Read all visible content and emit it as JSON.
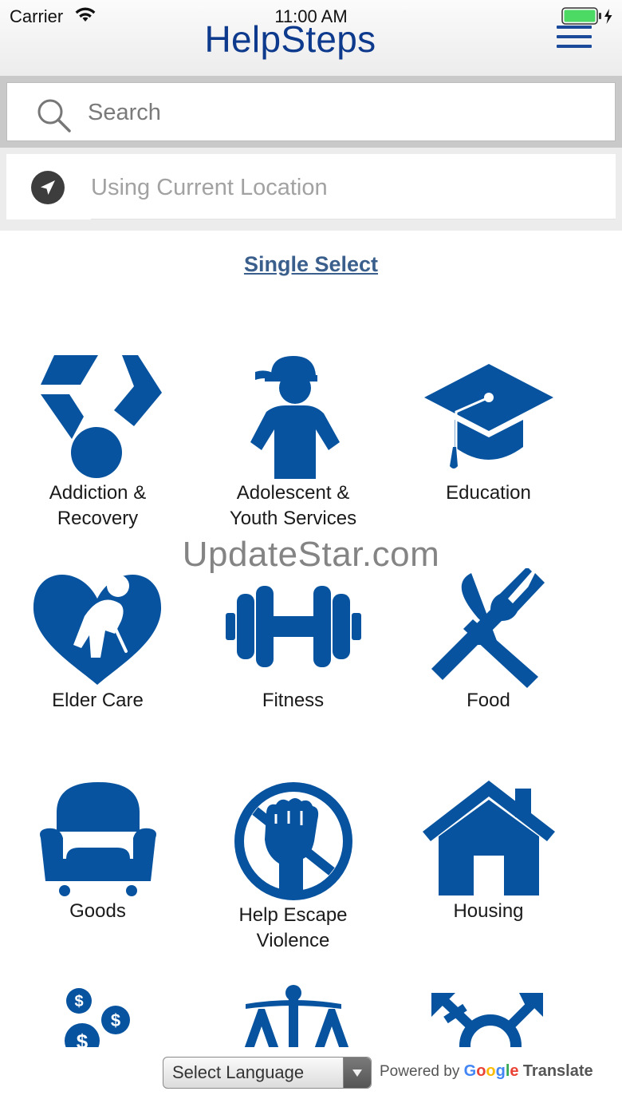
{
  "status_bar": {
    "carrier": "Carrier",
    "time": "11:00 AM"
  },
  "header": {
    "title": "HelpSteps"
  },
  "search": {
    "placeholder": "Search"
  },
  "location": {
    "placeholder": "Using Current Location"
  },
  "single_select": {
    "label": "Single Select"
  },
  "categories": [
    {
      "label": "Addiction &\nRecovery",
      "icon": "medal-icon"
    },
    {
      "label": "Adolescent &\nYouth Services",
      "icon": "youth-icon"
    },
    {
      "label": "Education",
      "icon": "graduation-cap-icon"
    },
    {
      "label": "Elder Care",
      "icon": "elder-heart-icon"
    },
    {
      "label": "Fitness",
      "icon": "dumbbell-icon"
    },
    {
      "label": "Food",
      "icon": "fork-knife-icon"
    },
    {
      "label": "Goods",
      "icon": "armchair-icon"
    },
    {
      "label": "Help Escape\nViolence",
      "icon": "no-violence-icon"
    },
    {
      "label": "Housing",
      "icon": "house-icon"
    },
    {
      "label": "",
      "icon": "money-icon"
    },
    {
      "label": "",
      "icon": "scales-icon"
    },
    {
      "label": "",
      "icon": "gender-icon"
    }
  ],
  "watermark": "UpdateStar.com",
  "translate": {
    "select_label": "Select Language",
    "powered_by": "Powered by",
    "google": "Google",
    "translate_word": "Translate"
  },
  "colors": {
    "icon_blue": "#07539f",
    "title_blue": "#0d3a8c",
    "link_blue": "#3b5f8c"
  }
}
